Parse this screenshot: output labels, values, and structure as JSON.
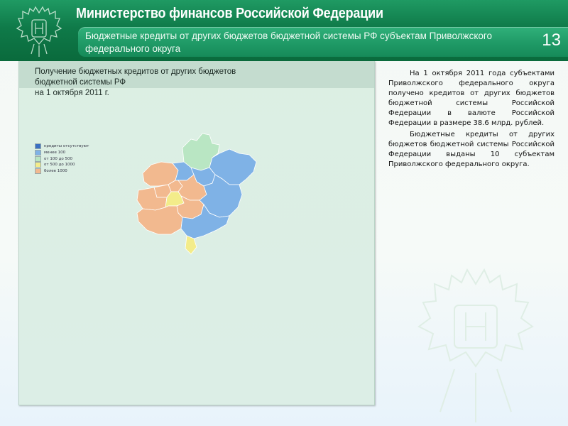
{
  "header": {
    "ministry_name": "Министерство финансов Российской Федерации",
    "slide_title": "Бюджетные кредиты от других бюджетов бюджетной системы РФ субъектам Приволжского федерального округа",
    "slide_number": "13"
  },
  "left_panel": {
    "title": "Получение бюджетных кредитов от других бюджетов\nбюджетной системы РФ\nна 1 октября 2011 г."
  },
  "legend": [
    {
      "label": "кредиты отсутствуют",
      "color": "#3a6fc2"
    },
    {
      "label": "менее 100",
      "color": "#7fb2e6"
    },
    {
      "label": "от 100 до 500",
      "color": "#b9e6c3"
    },
    {
      "label": "от 500 до 1000",
      "color": "#f3ec8a"
    },
    {
      "label": "более 1000",
      "color": "#f2b98f"
    }
  ],
  "map_regions": [
    {
      "name": "Нижегородская обл.",
      "color": "#f2b98f"
    },
    {
      "name": "Кировская обл.",
      "color": "#b9e6c3"
    },
    {
      "name": "Пермский край",
      "color": "#7fb2e6"
    },
    {
      "name": "Удмуртская Республика",
      "color": "#7fb2e6"
    },
    {
      "name": "Чувашская Республика",
      "color": "#f2b98f"
    },
    {
      "name": "Республика Марий Эл",
      "color": "#7fb2e6"
    },
    {
      "name": "Республика Мордовия",
      "color": "#f2b98f"
    },
    {
      "name": "Пензенская обл.",
      "color": "#f2b98f"
    },
    {
      "name": "Ульяновская обл.",
      "color": "#f3ec8a"
    },
    {
      "name": "Республика Татарстан",
      "color": "#f2b98f"
    },
    {
      "name": "Республика Башкортостан",
      "color": "#7fb2e6"
    },
    {
      "name": "Самарская обл.",
      "color": "#f2b98f"
    },
    {
      "name": "Саратовская обл.",
      "color": "#f2b98f"
    },
    {
      "name": "Оренбургская обл.",
      "color": "#7fb2e6"
    }
  ],
  "right_text": {
    "paragraph_1": "На 1 октября 2011 года субъектами Приволжского федерального округа получено кредитов от других бюджетов бюджетной системы Российской Федерации в валюте Российской Федерации в размере 38.6 млрд. рублей.",
    "paragraph_2": "Бюджетные кредиты от других бюджетов бюджетной системы Российской Федерации выданы 10 субъектам Приволжского федерального округа."
  },
  "colors": {
    "header_green": "#0f7a49",
    "banner_green": "#1f9a66",
    "panel_bg": "#dcefe3"
  }
}
